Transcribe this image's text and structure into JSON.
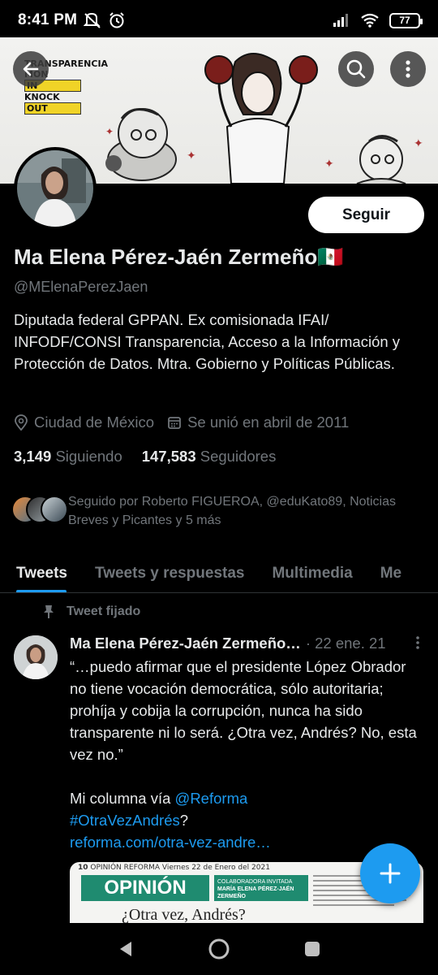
{
  "status_bar": {
    "time": "8:41 PM",
    "battery": "77",
    "icons": [
      "mute-icon",
      "alarm-icon",
      "signal-icon",
      "wifi-icon",
      "battery-icon"
    ]
  },
  "banner": {
    "tag_line1": "TRANSPARENCIA",
    "tag_line2": "MON",
    "tag_line3": "IN",
    "tag_line4": "KNOCK",
    "tag_line5": "OUT"
  },
  "profile": {
    "follow_label": "Seguir",
    "name": "Ma Elena Pérez-Jaén Zermeño🇲🇽",
    "handle": "@MElenaPerezJaen",
    "bio": "Diputada federal GPPAN. Ex comisionada IFAI/ INFODF/CONSI Transparencia, Acceso a la Información y Protección de Datos. Mtra. Gobierno y Políticas Públicas.",
    "location": "Ciudad de México",
    "joined": "Se unió en abril de 2011",
    "following_count": "3,149",
    "following_label": "Siguiendo",
    "followers_count": "147,583",
    "followers_label": "Seguidores",
    "followed_by": "Seguido por Roberto FIGUEROA, @eduKato89, Noticias Breves y Picantes y 5 más"
  },
  "tabs": [
    {
      "label": "Tweets",
      "active": true
    },
    {
      "label": "Tweets y respuestas",
      "active": false
    },
    {
      "label": "Multimedia",
      "active": false
    },
    {
      "label": "Me",
      "active": false
    }
  ],
  "tweet": {
    "pinned_label": "Tweet fijado",
    "author": "Ma Elena Pérez-Jaén Zermeño…",
    "date": "· 22 ene. 21",
    "text_quote": "“…puedo afirmar que el presidente López Obrador no tiene vocación democrática, sólo autoritaria; prohíja y cobija la corrupción, nunca ha sido transparente ni lo será. ¿Otra vez, Andrés? No, esta vez no.”",
    "text_prefix": "Mi columna vía ",
    "mention": "@Reforma",
    "hashtag": "#OtraVezAndrés",
    "hashtag_suffix": "?",
    "url": "reforma.com/otra-vez-andre…",
    "card_section": "OPINIÓN",
    "card_page": "10",
    "card_header": "OPINIÓN  REFORMA  Viernes 22 de Enero del 2021",
    "card_collab": "COLABORADORA INVITADA",
    "card_author": "MARÍA ELENA PÉREZ-JAÉN ZERMEÑO",
    "card_title": "¿Otra vez, Andrés?"
  },
  "colors": {
    "accent": "#1d9bf0",
    "background": "#000000",
    "text": "#e7e9ea",
    "muted": "#71767b"
  }
}
